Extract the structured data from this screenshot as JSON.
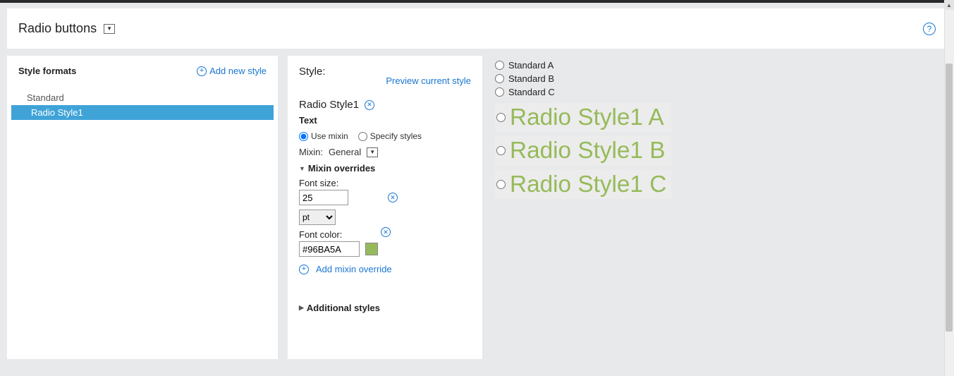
{
  "header": {
    "title": "Radio buttons"
  },
  "left": {
    "title": "Style formats",
    "add_label": "Add new style",
    "items": [
      "Standard",
      "Radio Style1"
    ],
    "selected_index": 1
  },
  "mid": {
    "title": "Style:",
    "preview_label": "Preview current style",
    "style_name": "Radio Style1",
    "text_section": "Text",
    "use_mixin_label": "Use mixin",
    "specify_label": "Specify styles",
    "mixin_label": "Mixin:",
    "mixin_value": "General",
    "overrides_label": "Mixin overrides",
    "font_size_label": "Font size:",
    "font_size_value": "25",
    "font_unit": "pt",
    "font_color_label": "Font color:",
    "font_color_value": "#96BA5A",
    "add_override_label": "Add mixin override",
    "additional_label": "Additional styles"
  },
  "preview": {
    "standard": [
      "Standard A",
      "Standard B",
      "Standard C"
    ],
    "styled": [
      "Radio Style1 A",
      "Radio Style1 B",
      "Radio Style1 C"
    ]
  }
}
